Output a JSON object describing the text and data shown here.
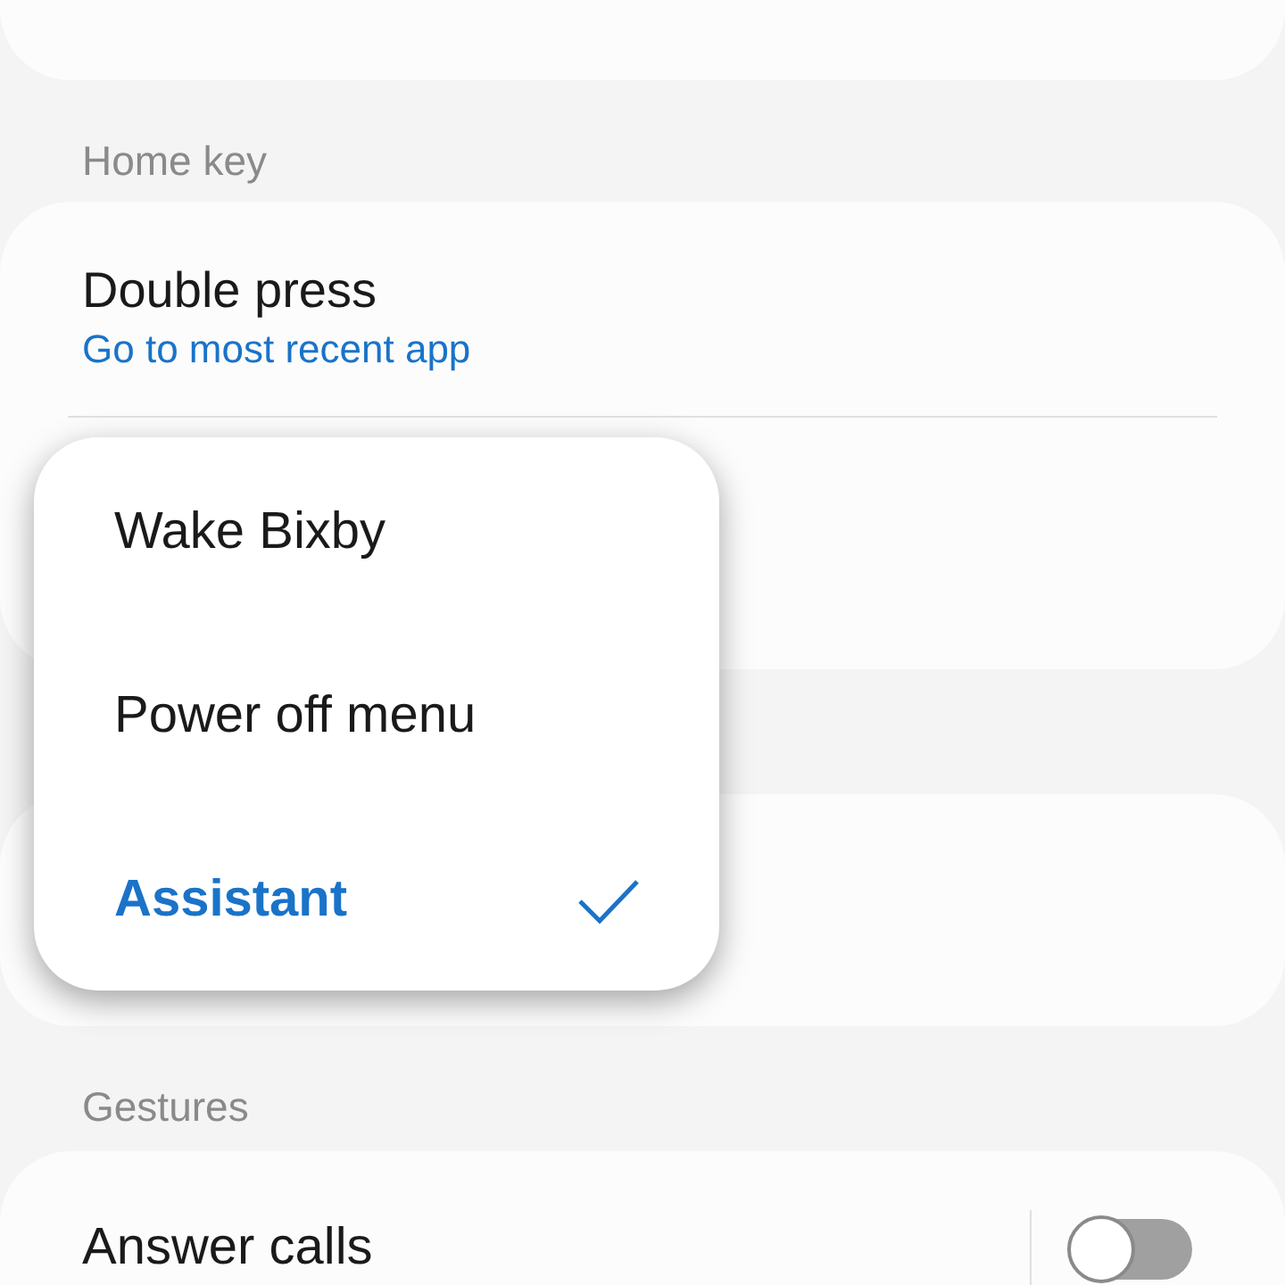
{
  "sections": [
    {
      "header": "Home key",
      "items": [
        {
          "title": "Double press",
          "subtitle": "Go to most recent app"
        }
      ]
    },
    {
      "header": "Gestures",
      "items": [
        {
          "title": "Answer calls",
          "on": false
        }
      ]
    }
  ],
  "popup_menu": {
    "options": [
      {
        "label": "Wake Bixby",
        "selected": false
      },
      {
        "label": "Power off menu",
        "selected": false
      },
      {
        "label": "Assistant",
        "selected": true
      }
    ]
  }
}
